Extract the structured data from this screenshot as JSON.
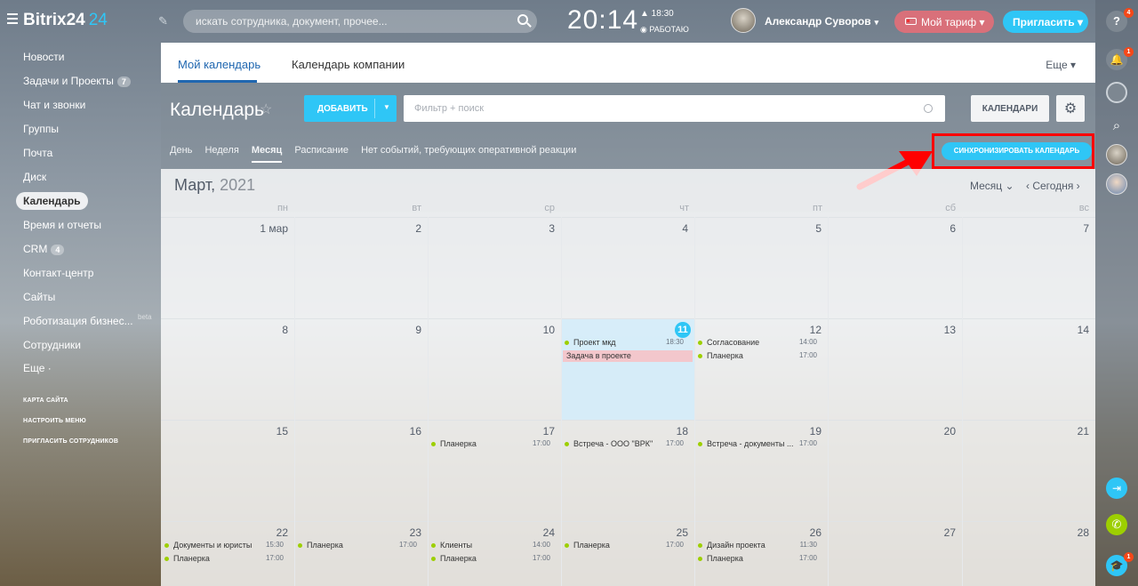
{
  "topbar": {
    "logo_text": "Bitrix24",
    "logo_num": "24",
    "search_placeholder": "искать сотрудника, документ, прочее...",
    "clock": "20:14",
    "clock_small": "▲ 18:30",
    "status": "◉ РАБОТАЮ",
    "user_name": "Александр Суворов",
    "tariff_label": "Мой тариф",
    "invite_label": "Пригласить"
  },
  "sidebar": {
    "items": [
      {
        "label": "Новости"
      },
      {
        "label": "Задачи и Проекты",
        "badge": "7"
      },
      {
        "label": "Чат и звонки"
      },
      {
        "label": "Группы"
      },
      {
        "label": "Почта"
      },
      {
        "label": "Диск"
      },
      {
        "label": "Календарь",
        "active": true
      },
      {
        "label": "Время и отчеты"
      },
      {
        "label": "CRM",
        "badge": "4"
      },
      {
        "label": "Контакт-центр"
      },
      {
        "label": "Сайты"
      },
      {
        "label": "Роботизация бизнес..."
      },
      {
        "label": "Сотрудники"
      },
      {
        "label": "Еще ·"
      }
    ],
    "beta": "beta",
    "links": [
      "КАРТА САЙТА",
      "НАСТРОИТЬ МЕНЮ",
      "ПРИГЛАСИТЬ СОТРУДНИКОВ"
    ]
  },
  "rightbar": {
    "help_badge": "4",
    "notif_badge": "1",
    "edu_badge": "1"
  },
  "tabs": {
    "my_calendar": "Мой календарь",
    "company_calendar": "Календарь компании",
    "more": "Еще"
  },
  "header": {
    "title": "Календарь",
    "add_label": "ДОБАВИТЬ",
    "filter_placeholder": "Фильтр + поиск",
    "calendars_label": "КАЛЕНДАРИ",
    "views": [
      "День",
      "Неделя",
      "Месяц",
      "Расписание",
      "Нет событий, требующих оперативной реакции"
    ],
    "sync_label": "СИНХРОНИЗИРОВАТЬ КАЛЕНДАРЬ"
  },
  "calendar": {
    "month": "Март,",
    "year": "2021",
    "mode": "Месяц",
    "today": "Сегодня",
    "weekdays": [
      "пн",
      "вт",
      "ср",
      "чт",
      "пт",
      "сб",
      "вс"
    ],
    "weeks": [
      [
        "1 мар",
        "2",
        "3",
        "4",
        "5",
        "6",
        "7"
      ],
      [
        "8",
        "9",
        "10",
        "11",
        "12",
        "13",
        "14"
      ],
      [
        "15",
        "16",
        "17",
        "18",
        "19",
        "20",
        "21"
      ],
      [
        "22",
        "23",
        "24",
        "25",
        "26",
        "27",
        "28"
      ]
    ],
    "events": {
      "w1d4_1": {
        "name": "Проект мкд",
        "time": "18:30"
      },
      "w1d4_task": {
        "name": "Задача в проекте"
      },
      "w1d5_1": {
        "name": "Согласование",
        "time": "14:00"
      },
      "w1d5_2": {
        "name": "Планерка",
        "time": "17:00"
      },
      "w2d3_1": {
        "name": "Планерка",
        "time": "17:00"
      },
      "w2d4_1": {
        "name": "Встреча - ООО \"ВРК\"",
        "time": "17:00"
      },
      "w2d5_1": {
        "name": "Встреча - документы ...",
        "time": "17:00"
      },
      "w3d1_1": {
        "name": "Документы и юристы",
        "time": "15:30"
      },
      "w3d1_2": {
        "name": "Планерка",
        "time": "17:00"
      },
      "w3d2_1": {
        "name": "Планерка",
        "time": "17:00"
      },
      "w3d3_1": {
        "name": "Клиенты",
        "time": "14:00"
      },
      "w3d3_2": {
        "name": "Планерка",
        "time": "17:00"
      },
      "w3d4_1": {
        "name": "Планерка",
        "time": "17:00"
      },
      "w3d5_1": {
        "name": "Дизайн проекта",
        "time": "11:30"
      },
      "w3d5_2": {
        "name": "Планерка",
        "time": "17:00"
      }
    }
  },
  "colors": {
    "accent": "#2fc6f6",
    "tab_active": "#2067b0",
    "event_dot": "#9dcf00",
    "task_bg": "#f3c7cc",
    "highlight": "#ff0000"
  }
}
